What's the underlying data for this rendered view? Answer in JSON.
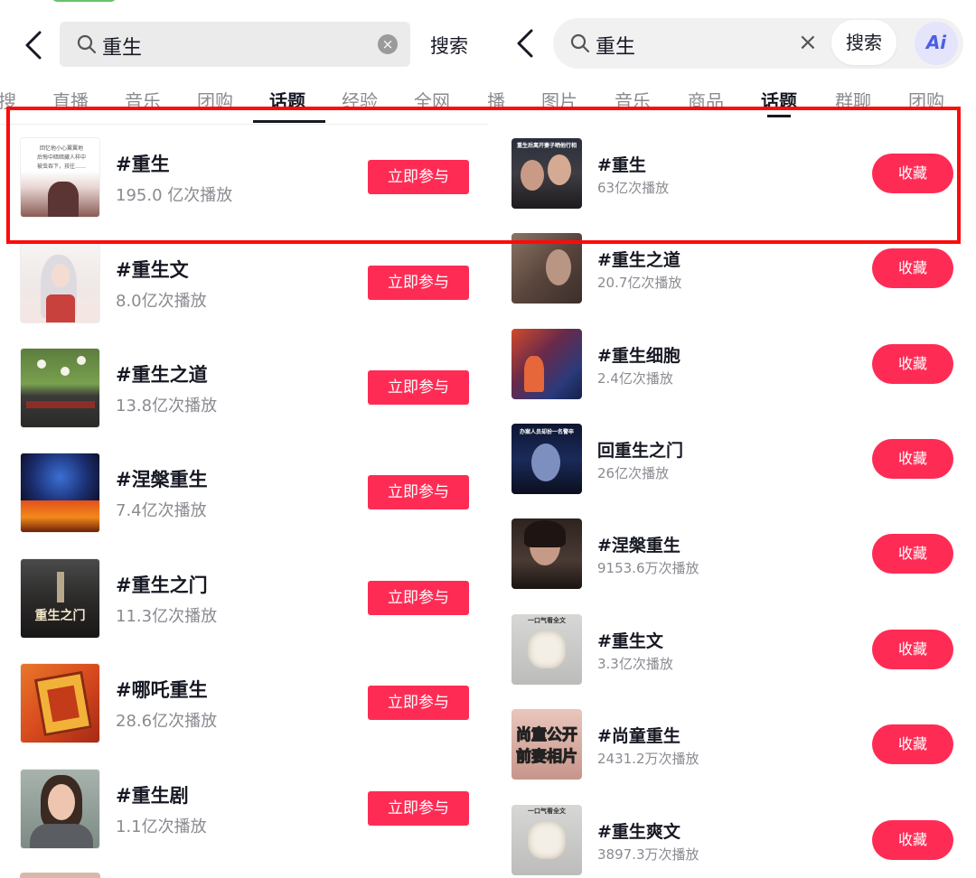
{
  "left": {
    "search": {
      "query": "重生",
      "button": "搜索"
    },
    "tabs": [
      "搜",
      "直播",
      "音乐",
      "团购",
      "话题",
      "经验",
      "全网"
    ],
    "active_tab": "话题",
    "join_label": "立即参与",
    "topics": [
      {
        "title": "#重生",
        "count": "195.0 亿次播放",
        "thumb_lines": [
          "回忆他小心翼翼地",
          "后悔中暗暗藏人样中",
          "被虫吞下，孩往……"
        ]
      },
      {
        "title": "#重生文",
        "count": "8.0亿次播放"
      },
      {
        "title": "#重生之道",
        "count": "13.8亿次播放"
      },
      {
        "title": "#涅槃重生",
        "count": "7.4亿次播放"
      },
      {
        "title": "#重生之门",
        "count": "11.3亿次播放",
        "thumb_text": "重生之门"
      },
      {
        "title": "#哪吒重生",
        "count": "28.6亿次播放"
      },
      {
        "title": "#重生剧",
        "count": "1.1亿次播放"
      }
    ]
  },
  "right": {
    "search": {
      "query": "重生",
      "clear": "×",
      "button": "搜索",
      "ai": "Ai"
    },
    "tabs": [
      "播",
      "图片",
      "音乐",
      "商品",
      "话题",
      "群聊",
      "团购"
    ],
    "active_tab": "话题",
    "fav_label": "收藏",
    "topics": [
      {
        "title": "#重生",
        "count": "63亿次播放",
        "thumb_text": "重生后离开妻子晒他行相"
      },
      {
        "title": "#重生之道",
        "count": "20.7亿次播放"
      },
      {
        "title": "#重生细胞",
        "count": "2.4亿次播放"
      },
      {
        "title": "回重生之门",
        "count": "26亿次播放",
        "thumb_text": "办案人员却扮一名警卒"
      },
      {
        "title": "#涅槃重生",
        "count": "9153.6万次播放"
      },
      {
        "title": "#重生文",
        "count": "3.3亿次播放",
        "thumb_text": "一口气看全文"
      },
      {
        "title": "#尚童重生",
        "count": "2431.2万次播放",
        "thumb_lines": [
          "尚童公开",
          "前妻相片"
        ]
      },
      {
        "title": "#重生爽文",
        "count": "3897.3万次播放",
        "thumb_text": "一口气看全文"
      }
    ]
  },
  "colors": {
    "accent": "#fe2c55",
    "highlight": "#ff0a0a",
    "ai": "#4a5fe8"
  },
  "icons": [
    "back-arrow-icon",
    "search-icon",
    "clear-icon",
    "ai-icon"
  ]
}
